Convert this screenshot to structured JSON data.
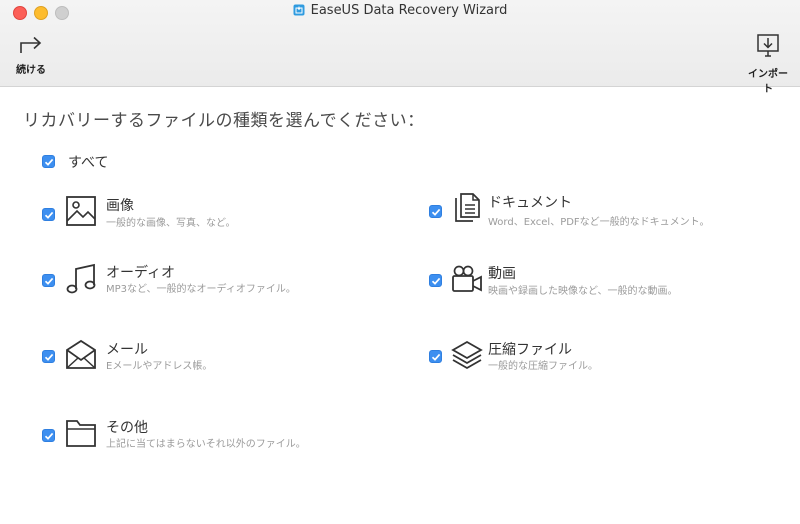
{
  "window": {
    "title": "EaseUS Data Recovery Wizard"
  },
  "toolbar": {
    "continue_label": "続ける",
    "import_label": "インポート"
  },
  "heading": "リカバリーするファイルの種類を選んでください：",
  "select_all": {
    "label": "すべて",
    "checked": true
  },
  "categories": [
    {
      "title": "画像",
      "desc": "一般的な画像、写真、など。",
      "icon": "image-icon",
      "checked": true
    },
    {
      "title": "ドキュメント",
      "desc": "Word、Excel、PDFなど一般的なドキュメント。",
      "icon": "document-icon",
      "checked": true
    },
    {
      "title": "オーディオ",
      "desc": "MP3など、一般的なオーディオファイル。",
      "icon": "music-note-icon",
      "checked": true
    },
    {
      "title": "動画",
      "desc": "映画や録画した映像など、一般的な動画。",
      "icon": "video-camera-icon",
      "checked": true
    },
    {
      "title": "メール",
      "desc": "Eメールやアドレス帳。",
      "icon": "envelope-icon",
      "checked": true
    },
    {
      "title": "圧縮ファイル",
      "desc": "一般的な圧縮ファイル。",
      "icon": "layers-icon",
      "checked": true
    },
    {
      "title": "その他",
      "desc": "上記に当てはまらないそれ以外のファイル。",
      "icon": "folder-icon",
      "checked": true
    }
  ],
  "colors": {
    "checkbox": "#3d8ff0",
    "toolbar_bg": "#ececec"
  }
}
